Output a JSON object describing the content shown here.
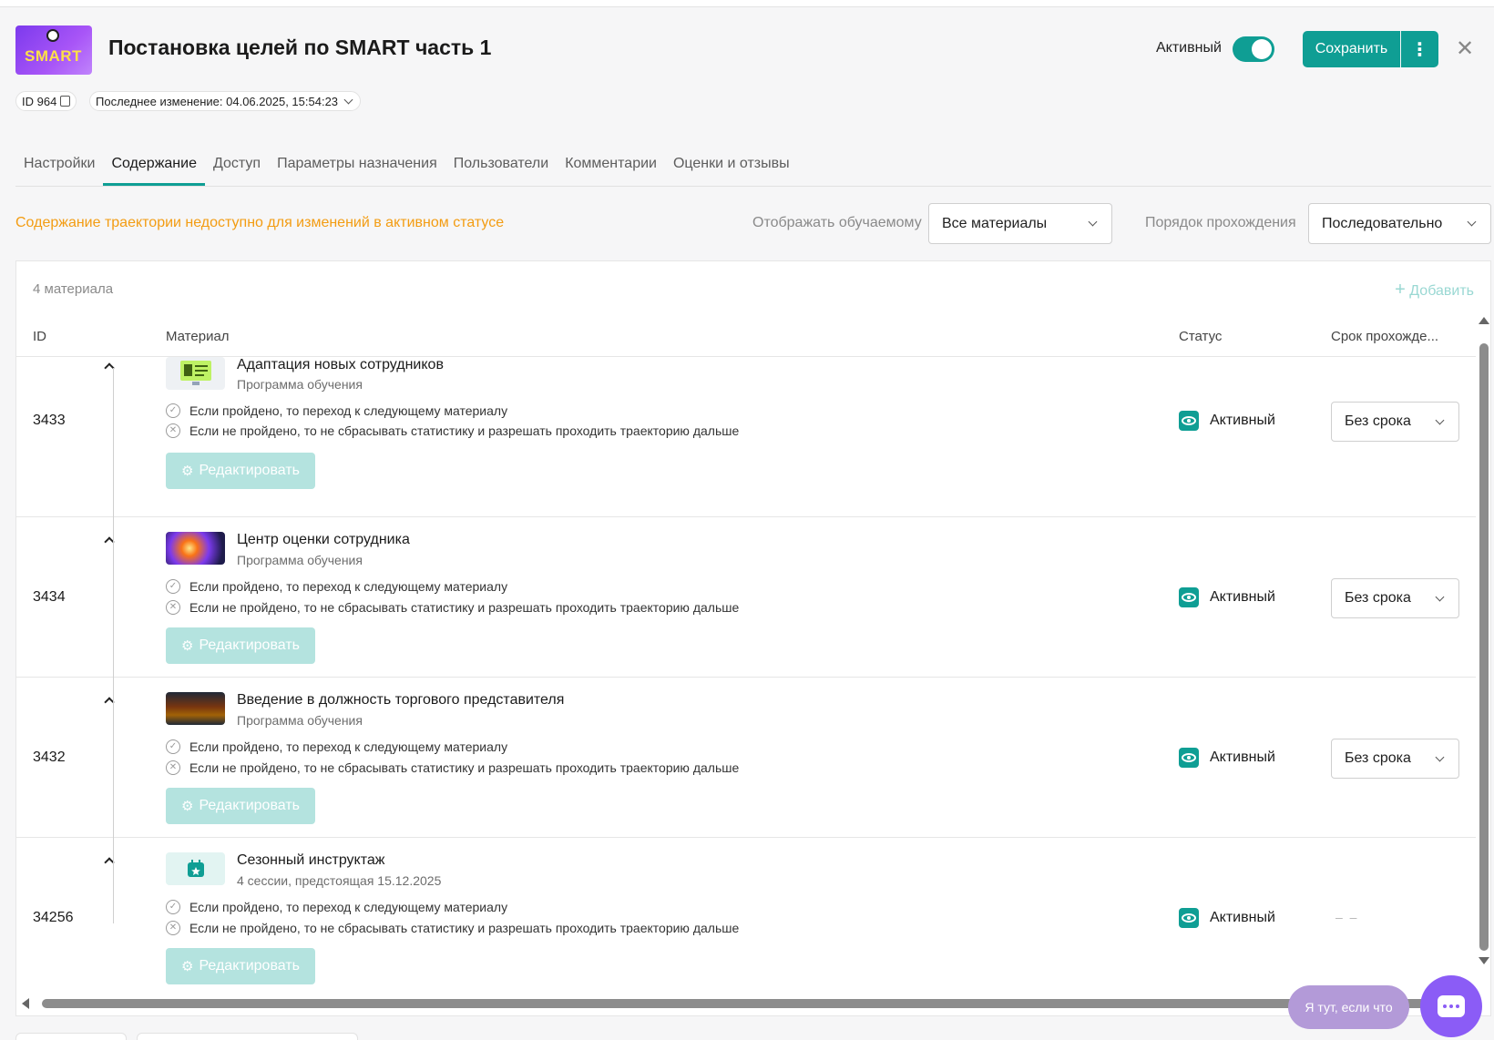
{
  "header": {
    "title": "Постановка целей по SMART часть 1",
    "logo_text": "SMART",
    "active_label": "Активный",
    "save_label": "Сохранить",
    "more_glyph": "⋮",
    "close_glyph": "✕",
    "id_label": "ID 964",
    "last_change": "Последнее изменение: 04.06.2025, 15:54:23"
  },
  "tabs": [
    {
      "label": "Настройки",
      "active": false
    },
    {
      "label": "Содержание",
      "active": true
    },
    {
      "label": "Доступ",
      "active": false
    },
    {
      "label": "Параметры назначения",
      "active": false
    },
    {
      "label": "Пользователи",
      "active": false
    },
    {
      "label": "Комментарии",
      "active": false
    },
    {
      "label": "Оценки и отзывы",
      "active": false
    }
  ],
  "notice": "Содержание траектории недоступно для изменений в активном статусе",
  "filters": {
    "display_label": "Отображать обучаемому",
    "display_value": "Все материалы",
    "order_label": "Порядок прохождения",
    "order_value": "Последовательно"
  },
  "table": {
    "count": "4 материала",
    "add_label": "Добавить",
    "columns": {
      "id": "ID",
      "material": "Материал",
      "status": "Статус",
      "due": "Срок прохожде..."
    },
    "rule_passed": "Если пройдено, то переход к следующему материалу",
    "rule_failed": "Если не пройдено, то не сбрасывать статистику и разрешать проходить траекторию дальше",
    "edit_label": "Редактировать",
    "rows": [
      {
        "id": "3433",
        "title": "Адаптация новых сотрудников",
        "subtitle": "Программа обучения",
        "status": "Активный",
        "due": "Без срока",
        "thumb": "monitor-illustration"
      },
      {
        "id": "3434",
        "title": "Центр оценки сотрудника",
        "subtitle": "Программа обучения",
        "status": "Активный",
        "due": "Без срока",
        "thumb": "nebula-photo"
      },
      {
        "id": "3432",
        "title": "Введение в должность торгового представителя",
        "subtitle": "Программа обучения",
        "status": "Активный",
        "due": "Без срока",
        "thumb": "office-photo"
      },
      {
        "id": "34256",
        "title": "Сезонный инструктаж",
        "subtitle": "4 сессии, предстоящая 15.12.2025",
        "status": "Активный",
        "due": "– –",
        "thumb": "calendar-icon"
      }
    ]
  },
  "help": {
    "pill_text": "Я тут, если что"
  },
  "colors": {
    "accent": "#0f9e94",
    "warning": "#f39c12",
    "chat": "#8b5cf6"
  }
}
